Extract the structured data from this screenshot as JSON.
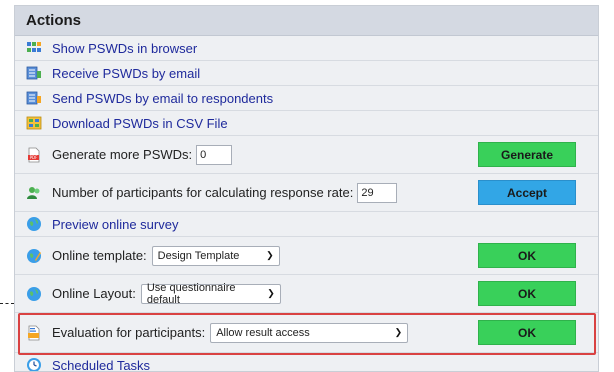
{
  "header": {
    "title": "Actions"
  },
  "rows": [
    {
      "label": "Show PSWDs in browser"
    },
    {
      "label": "Receive PSWDs by email"
    },
    {
      "label": "Send PSWDs by email to respondents"
    },
    {
      "label": "Download PSWDs in CSV File"
    },
    {
      "label": "Generate more PSWDs:",
      "input_value": "0",
      "button": "Generate"
    },
    {
      "label": "Number of participants for calculating response rate:",
      "input_value": "29",
      "button": "Accept"
    },
    {
      "label": "Preview online survey"
    },
    {
      "label": "Online template:",
      "select_value": "Design Template",
      "button": "OK"
    },
    {
      "label": "Online Layout:",
      "select_value": "Use questionnaire default",
      "button": "OK"
    },
    {
      "label": "Evaluation for participants:",
      "select_value": "Allow result access",
      "button": "OK"
    },
    {
      "label": "Scheduled Tasks"
    }
  ],
  "colors": {
    "green_button": "#39d05a",
    "blue_button": "#32a6e6",
    "highlight": "#d94242",
    "link": "#1f2a9c"
  }
}
